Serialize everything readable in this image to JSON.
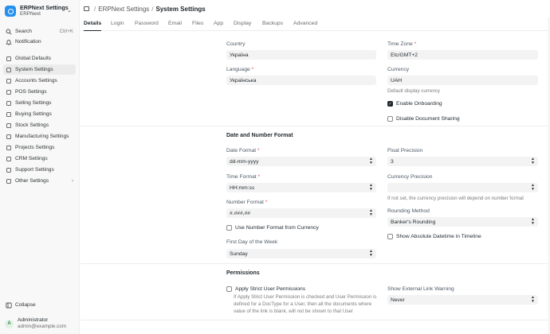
{
  "sidebar": {
    "brand_title": "ERPNext Settings",
    "brand_sub": "ERPNext",
    "search_label": "Search",
    "search_shortcut": "Ctrl+K",
    "notification_label": "Notification",
    "items": [
      {
        "label": "Global Defaults"
      },
      {
        "label": "System Settings"
      },
      {
        "label": "Accounts Settings"
      },
      {
        "label": "POS Settings"
      },
      {
        "label": "Selling Settings"
      },
      {
        "label": "Buying Settings"
      },
      {
        "label": "Stock Settings"
      },
      {
        "label": "Manufacturing Settings"
      },
      {
        "label": "Projects Settings"
      },
      {
        "label": "CRM Settings"
      },
      {
        "label": "Support Settings"
      },
      {
        "label": "Other Settings"
      }
    ],
    "collapse_label": "Collapse",
    "user_initial": "A",
    "user_name": "Administrator",
    "user_email": "admin@example.com"
  },
  "header": {
    "crumb_parent": "ERPNext Settings",
    "crumb_sep": "/",
    "crumb_current": "System Settings"
  },
  "tabs": [
    "Details",
    "Login",
    "Password",
    "Email",
    "Files",
    "App",
    "Display",
    "Backups",
    "Advanced"
  ],
  "details": {
    "country_label": "Country",
    "country_value": "Україна",
    "timezone_label": "Time Zone",
    "timezone_value": "Etc/GMT+2",
    "language_label": "Language",
    "language_value": "Українська",
    "currency_label": "Currency",
    "currency_value": "UAH",
    "currency_help": "Default display currency",
    "enable_onboarding": "Enable Onboarding",
    "disable_sharing": "Disable Document Sharing"
  },
  "date_number": {
    "title": "Date and Number Format",
    "date_format_label": "Date Format",
    "date_format_value": "dd-mm-yyyy",
    "float_precision_label": "Float Precision",
    "float_precision_value": "3",
    "time_format_label": "Time Format",
    "time_format_value": "HH:mm:ss",
    "currency_precision_label": "Currency Precision",
    "currency_precision_value": "",
    "currency_precision_help": "If not set, the currency precision will depend on number format",
    "number_format_label": "Number Format",
    "number_format_value": "#.###,##",
    "rounding_label": "Rounding Method",
    "rounding_value": "Banker's Rounding",
    "use_number_format": "Use Number Format from Currency",
    "show_absolute": "Show Absolute Datetime in Timeline",
    "first_day_label": "First Day of the Week",
    "first_day_value": "Sunday"
  },
  "permissions": {
    "title": "Permissions",
    "strict_label": "Apply Strict User Permissions",
    "strict_help": "If Apply Strict User Permission is checked and User Permission is defined for a DocType for a User, then all the documents where value of the link is blank, will not be shown to that User",
    "ext_link_label": "Show External Link Warning",
    "ext_link_value": "Never"
  },
  "required_mark": "*"
}
